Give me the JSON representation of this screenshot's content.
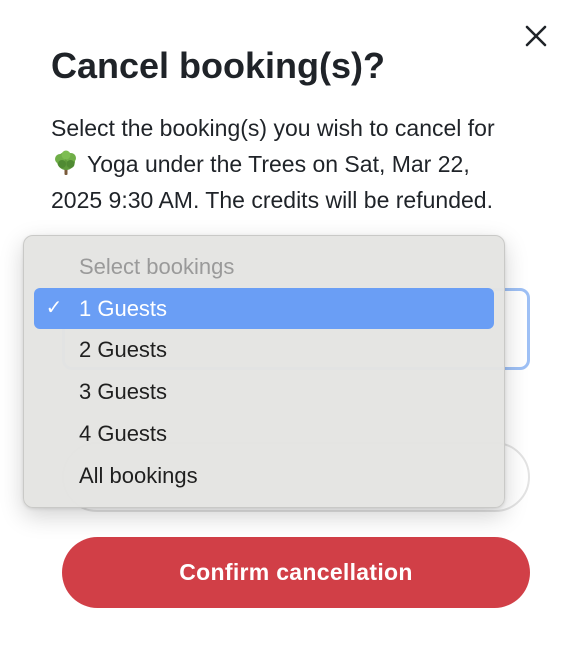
{
  "dialog": {
    "title": "Cancel booking(s)?",
    "description_prefix": "Select the booking(s) you wish to cancel for ",
    "class_icon": "deciduous-tree-icon",
    "description_suffix": " Yoga under the Trees on Sat, Mar 22, 2025 9:30 AM. The credits will be refunded."
  },
  "close": {
    "icon": "close-icon"
  },
  "bookings_select": {
    "placeholder": "Select bookings",
    "selected_value": "1 Guests",
    "options": [
      "1 Guests",
      "2 Guests",
      "3 Guests",
      "4 Guests",
      "All bookings"
    ],
    "check_mark": "✓"
  },
  "actions": {
    "confirm_label": "Confirm cancellation"
  },
  "colors": {
    "confirm_button": "#d13f47",
    "selected_option": "#6a9ef5",
    "focus_border": "#9ec0f5"
  }
}
